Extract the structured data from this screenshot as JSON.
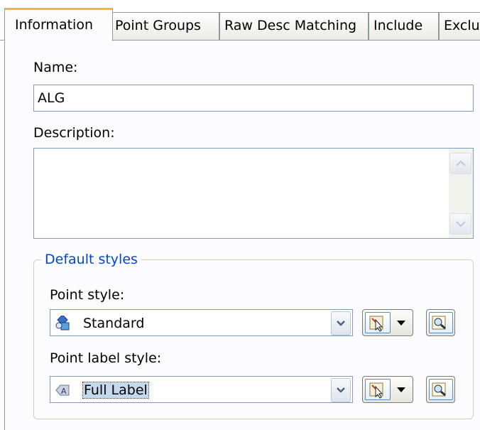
{
  "tabs": [
    {
      "label": "Information",
      "active": true
    },
    {
      "label": "Point Groups",
      "active": false
    },
    {
      "label": "Raw Desc Matching",
      "active": false
    },
    {
      "label": "Include",
      "active": false
    },
    {
      "label": "Exclu",
      "active": false
    }
  ],
  "name": {
    "label": "Name:",
    "value": "ALG"
  },
  "description": {
    "label": "Description:",
    "value": ""
  },
  "default_styles": {
    "legend": "Default styles",
    "point_style": {
      "label": "Point style:",
      "value": "Standard",
      "icon": "point-style-icon"
    },
    "point_label_style": {
      "label": "Point label style:",
      "value": "Full Label",
      "icon": "label-style-icon"
    }
  },
  "colors": {
    "tab_active_accent": "#f6b444",
    "legend_text": "#0046d5",
    "field_border": "#7f9db9"
  }
}
